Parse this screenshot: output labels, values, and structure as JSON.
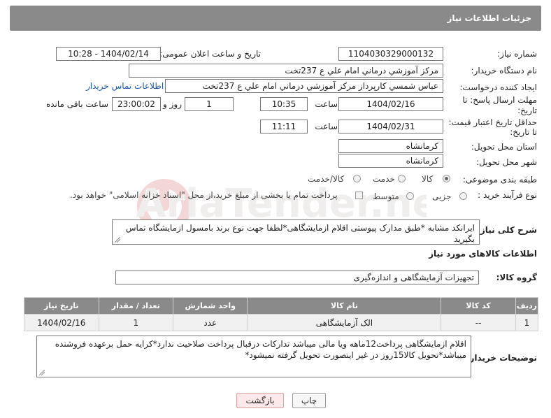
{
  "header": {
    "title": "جزئیات اطلاعات نیاز"
  },
  "fields": {
    "need_number_label": "شماره نیاز:",
    "need_number": "1104030329000132",
    "announce_label": "تاریخ و ساعت اعلان عمومی:",
    "announce_value": "1404/02/14 - 10:28",
    "buyer_org_label": "نام دستگاه خریدار:",
    "buyer_org": "مرکز آموزشي درماني امام علي ع 237تخت",
    "creator_label": "ایجاد کننده درخواست:",
    "creator": "عباس شمسي كارپرداز  مرکز آموزشي درماني امام علي ع 237تخت",
    "buyer_contact_link": "اطلاعات تماس خریدار",
    "deadline_label_1": "مهلت ارسال پاسخ: تا",
    "deadline_label_2": "تاریخ:",
    "deadline_date": "1404/02/16",
    "time_label": "ساعت",
    "deadline_time": "10:35",
    "days_value": "1",
    "days_label": "روز و",
    "remaining_time": "23:00:02",
    "remaining_label": "ساعت باقی مانده",
    "validity_label_1": "حداقل تاریخ اعتبار قیمت:",
    "validity_label_2": "تا تاریخ:",
    "validity_date": "1404/02/31",
    "validity_time": "11:11",
    "province_label": "استان محل تحویل:",
    "province": "کرمانشاه",
    "city_label": "شهر محل تحویل:",
    "city": "کرمانشاه",
    "category_label": "طبقه بندی موضوعی:",
    "category_options": [
      "کالا",
      "خدمت",
      "کالا/خدمت"
    ],
    "process_label": "نوع فرآیند خرید :",
    "process_options": [
      "جزیی",
      "متوسط"
    ],
    "payment_note": "پرداخت تمام یا بخشی از مبلغ خرید،از محل \"اسناد خزانه اسلامی\" خواهد بود."
  },
  "description": {
    "label": "شرح کلی نیاز:",
    "text": "ایرانکد مشابه *طبق مدارک پیوستی اقلام ازمایشگاهی*لطفا جهت نوع برند بامسول ازمایشگاه تماس بگیرید"
  },
  "goods": {
    "section_title": "اطلاعات کالاهای مورد نیاز",
    "group_label": "گروه کالا:",
    "group_value": "تجهیزات آزمایشگاهی و اندازه‌گیری",
    "columns": [
      "ردیف",
      "کد کالا",
      "نام کالا",
      "واحد شمارش",
      "تعداد / مقدار",
      "تاریخ نیاز"
    ],
    "rows": [
      [
        "1",
        "--",
        "الک آزمایشگاهی",
        "عدد",
        "1",
        "1404/02/16"
      ]
    ]
  },
  "buyer_notes": {
    "label": "توضیحات خریدار:",
    "text": "اقلام ازمایشگاهی پرداخت12ماهه ویا مالی میباشد تدارکات درقبال پرداخت صلاحیت ندارد*کرایه حمل برعهده فروشنده میباشد*تحویل کالا15روز در غیر اینصورت تحویل گرفته نمیشود*"
  },
  "buttons": {
    "print": "چاپ",
    "back": "بازگشت"
  },
  "watermark": {
    "text": "AriaTender.neT"
  }
}
